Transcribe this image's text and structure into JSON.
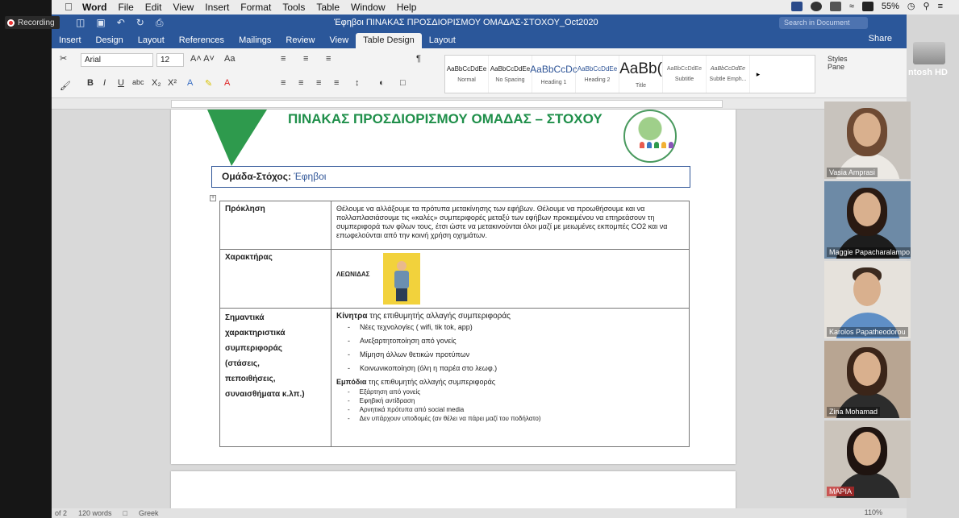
{
  "recording": {
    "label": "Recording"
  },
  "menubar": {
    "app": "Word",
    "items": [
      "File",
      "Edit",
      "View",
      "Insert",
      "Format",
      "Tools",
      "Table",
      "Window",
      "Help"
    ],
    "battery": "55%"
  },
  "window": {
    "title": "Έφηβοι ΠΙΝΑΚΑΣ ΠΡΟΣΔΙΟΡΙΣΜΟΥ ΟΜΑΔΑΣ-ΣΤΟΧΟΥ_Oct2020",
    "search_placeholder": "Search in Document",
    "share": "Share"
  },
  "ribbon_tabs": [
    "Insert",
    "Design",
    "Layout",
    "References",
    "Mailings",
    "Review",
    "View",
    "Table Design",
    "Layout"
  ],
  "ribbon_active_tab_index": 7,
  "ribbon": {
    "font": "Arial",
    "size": "12",
    "styles": [
      {
        "sample": "AaBbCcDdEe",
        "name": "Normal"
      },
      {
        "sample": "AaBbCcDdEe",
        "name": "No Spacing"
      },
      {
        "sample": "AaBbCcDc",
        "name": "Heading 1"
      },
      {
        "sample": "AaBbCcDdEe",
        "name": "Heading 2"
      },
      {
        "sample": "AaBb(",
        "name": "Title"
      },
      {
        "sample": "AaBbCcDdEe",
        "name": "Subtitle"
      },
      {
        "sample": "AaBbCcDdEe",
        "name": "Subtle Emph..."
      }
    ],
    "styles_pane": "Styles Pane"
  },
  "desktop": {
    "drive_label": "ntosh HD"
  },
  "document": {
    "heading": "ΠΙΝΑΚΑΣ ΠΡΟΣΔΙΟΡΙΣΜΟΥ ΟΜΑΔΑΣ – ΣΤΟΧΟΥ",
    "target_label": "Ομάδα-Στόχος:",
    "target_value": "Έφηβοι",
    "rows": {
      "challenge_label": "Πρόκληση",
      "challenge_text": "Θέλουμε να αλλάξουμε τα πρότυπα μετακίνησης των εφήβων. Θέλουμε να προωθήσουμε και να πολλαπλασιάσουμε τις «καλές» συμπεριφορές μεταξύ των εφήβων προκειμένου να επηρεάσουν τη συμπεριφορά των φίλων τους, έτσι ώστε να μετακινούνται όλοι μαζί με μειωμένες εκπομπές CO2 και να επωφελούνται από την κοινή χρήση οχημάτων.",
      "character_label": "Χαρακτήρας",
      "character_name": "ΛΕΩΝΙΔΑΣ",
      "features_label_lines": [
        "Σημαντικά",
        "χαρακτηριστικά",
        "συμπεριφοράς",
        "(στάσεις,",
        "πεποιθήσεις,",
        "συναισθήματα κ.λπ.)"
      ],
      "motives_title_bold": "Κίνητρα",
      "motives_title_rest": " της επιθυμητής αλλαγής συμπεριφοράς",
      "motives": [
        "Νέες τεχνολογίες ( wifi, tik tok, app)",
        "Ανεξαρτητοποίηση από γονείς",
        "Μίμηση άλλων θετικών προτύπων",
        "Κοινωνικοποίηση (όλη η παρέα στο λεωφ.)"
      ],
      "obstacles_title_bold": "Εμπόδια",
      "obstacles_title_rest": " της επιθυμητής αλλαγής συμπεριφοράς",
      "obstacles": [
        "Εξάρτηση από γονείς",
        "Εφηβική αντίδραση",
        "Αρνητικά πρότυπα από social media",
        "Δεν υπάρχουν υποδομές (αν θέλει να πάρει μαζί του ποδήλατο)"
      ]
    }
  },
  "statusbar": {
    "page": "of 2",
    "words": "120 words",
    "language": "Greek",
    "zoom": "110%"
  },
  "participants": [
    {
      "name": "Vasia Amprasi"
    },
    {
      "name": "Maggie Papacharalampo..."
    },
    {
      "name": "Karolos Papatheodorou"
    },
    {
      "name": "Zina Mohamad"
    },
    {
      "name": "ΜΑΡΙΑ"
    }
  ]
}
